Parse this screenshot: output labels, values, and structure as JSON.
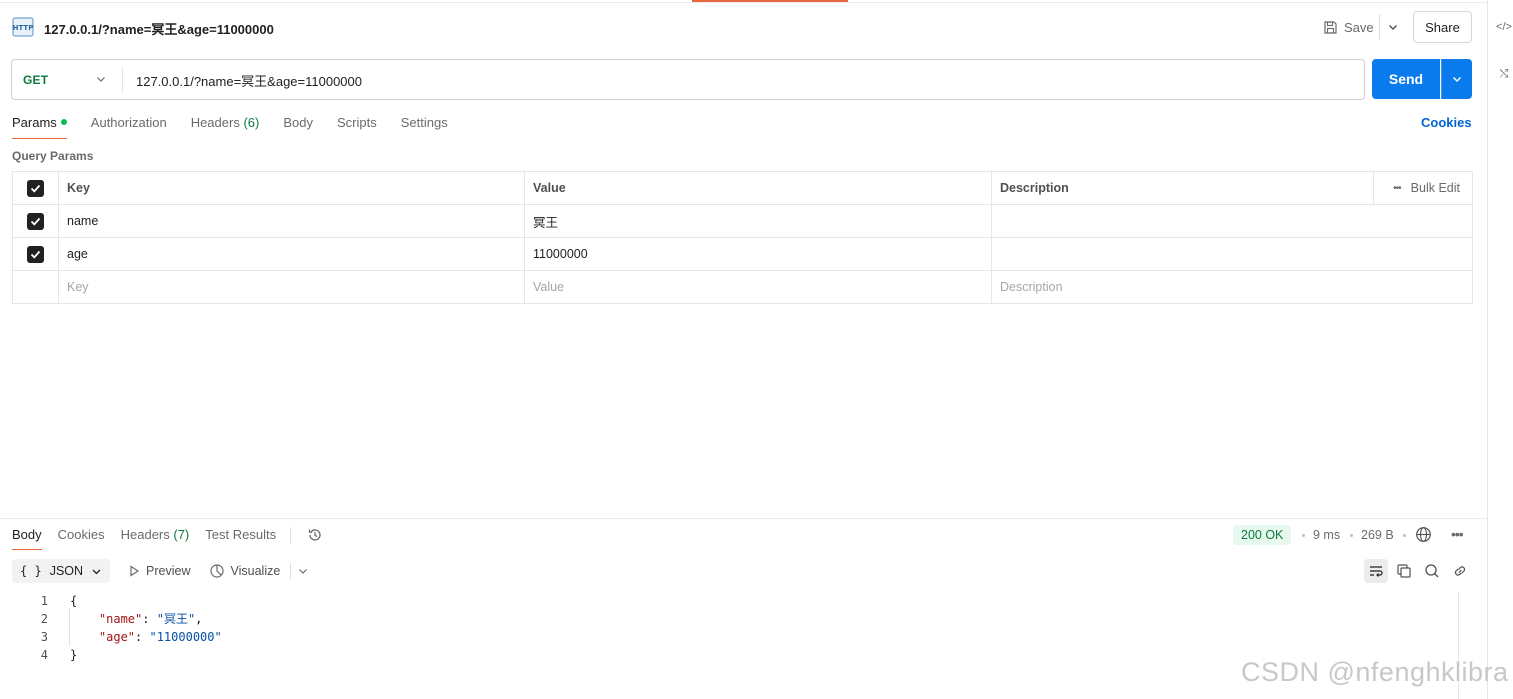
{
  "request": {
    "title": "127.0.0.1/?name=冥王&age=11000000",
    "method": "GET",
    "url": "127.0.0.1/?name=冥王&age=11000000",
    "save_label": "Save",
    "share_label": "Share",
    "send_label": "Send"
  },
  "tabs": [
    {
      "label": "Params"
    },
    {
      "label": "Authorization"
    },
    {
      "label": "Headers",
      "count": "(6)"
    },
    {
      "label": "Body"
    },
    {
      "label": "Scripts"
    },
    {
      "label": "Settings"
    }
  ],
  "cookies_label": "Cookies",
  "query_params": {
    "section_label": "Query Params",
    "headers": {
      "key": "Key",
      "value": "Value",
      "description": "Description",
      "bulk_edit": "Bulk Edit"
    },
    "rows": [
      {
        "key": "name",
        "value": "冥王",
        "checked": true
      },
      {
        "key": "age",
        "value": "11000000",
        "checked": true
      }
    ],
    "placeholders": {
      "key": "Key",
      "value": "Value",
      "description": "Description"
    }
  },
  "response": {
    "tabs": [
      {
        "label": "Body"
      },
      {
        "label": "Cookies"
      },
      {
        "label": "Headers",
        "count": "(7)"
      },
      {
        "label": "Test Results"
      }
    ],
    "status": "200 OK",
    "time": "9 ms",
    "size": "269 B",
    "format": "JSON",
    "format_prefix": "{ }",
    "preview_label": "Preview",
    "visualize_label": "Visualize",
    "code_lines": [
      {
        "n": "1",
        "indent": "",
        "key": "",
        "val": "",
        "text": "{"
      },
      {
        "n": "2",
        "indent": "    ",
        "key": "\"name\"",
        "val": "\"冥王\"",
        "text": ","
      },
      {
        "n": "3",
        "indent": "    ",
        "key": "\"age\"",
        "val": "\"11000000\"",
        "text": ""
      },
      {
        "n": "4",
        "indent": "",
        "key": "",
        "val": "",
        "text": "}"
      }
    ]
  },
  "watermark": "CSDN @nfenghklibra",
  "colors": {
    "accent": "#e8663c",
    "send": "#097bed",
    "get": "#0b7a3e",
    "link": "#0265d2"
  }
}
